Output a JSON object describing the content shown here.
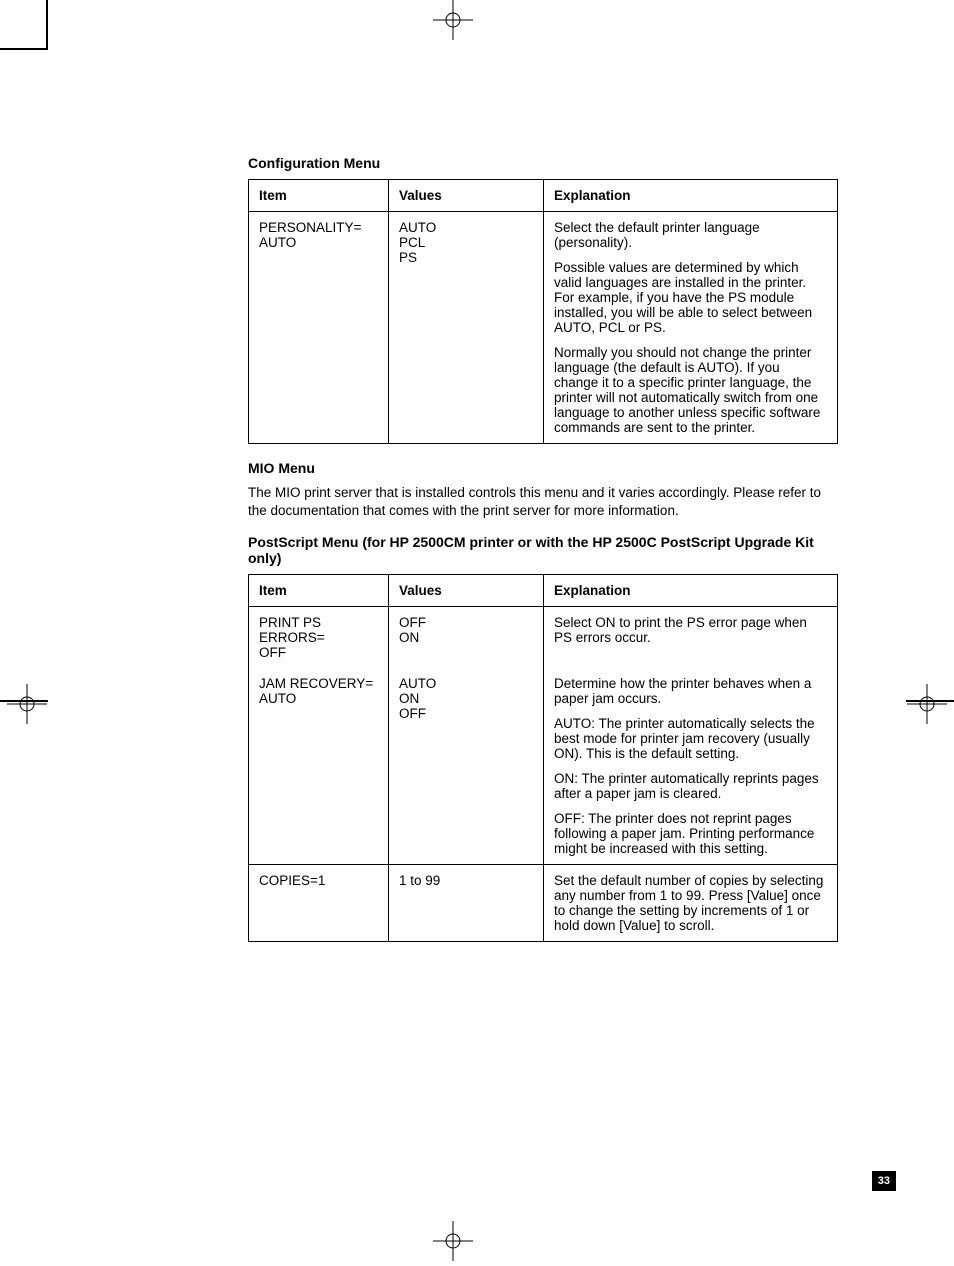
{
  "page_number": "33",
  "configMenu": {
    "title": "Configuration Menu",
    "headers": {
      "item": "Item",
      "values": "Values",
      "explanation": "Explanation"
    },
    "rows": [
      {
        "item": "PERSONALITY=\nAUTO",
        "values": "AUTO\nPCL\nPS",
        "explanation": [
          "Select the default printer language (personality).",
          "Possible values are determined by which valid languages are installed in the printer. For example, if you have the PS module installed, you will be able to select between AUTO, PCL or PS.",
          "Normally you should not change the printer language (the default is AUTO). If you change it to a specific printer language, the printer will not automatically switch from one language to another unless specific software commands are sent to the printer."
        ]
      }
    ]
  },
  "mioMenu": {
    "title": "MIO Menu",
    "text": "The MIO print server that is installed controls this menu and it varies accordingly. Please refer to the documentation that comes with the print server for more information."
  },
  "postscriptMenu": {
    "title": "PostScript Menu (for HP 2500CM printer or with the HP 2500C PostScript Upgrade Kit only)",
    "headers": {
      "item": "Item",
      "values": "Values",
      "explanation": "Explanation"
    },
    "rows": [
      {
        "item": "PRINT PS ERRORS=\nOFF",
        "values": "OFF\nON",
        "explanation": [
          "Select ON to print the PS error page when PS errors occur."
        ]
      },
      {
        "item": "JAM RECOVERY=\nAUTO",
        "values": "AUTO\nON\nOFF",
        "explanation": [
          "Determine how the printer behaves when a paper jam occurs.",
          "AUTO: The printer automatically selects the best mode for printer jam recovery (usually ON). This is the default setting.",
          "ON: The printer automatically reprints pages after a paper jam is cleared.",
          "OFF: The printer does not reprint pages following a paper jam. Printing performance might be increased with this setting."
        ]
      },
      {
        "item": "COPIES=1",
        "values": "1 to 99",
        "explanation": [
          "Set the default number of copies by selecting any number from 1 to 99. Press [Value] once to change the setting by increments of 1 or hold down [Value] to scroll."
        ]
      }
    ]
  }
}
